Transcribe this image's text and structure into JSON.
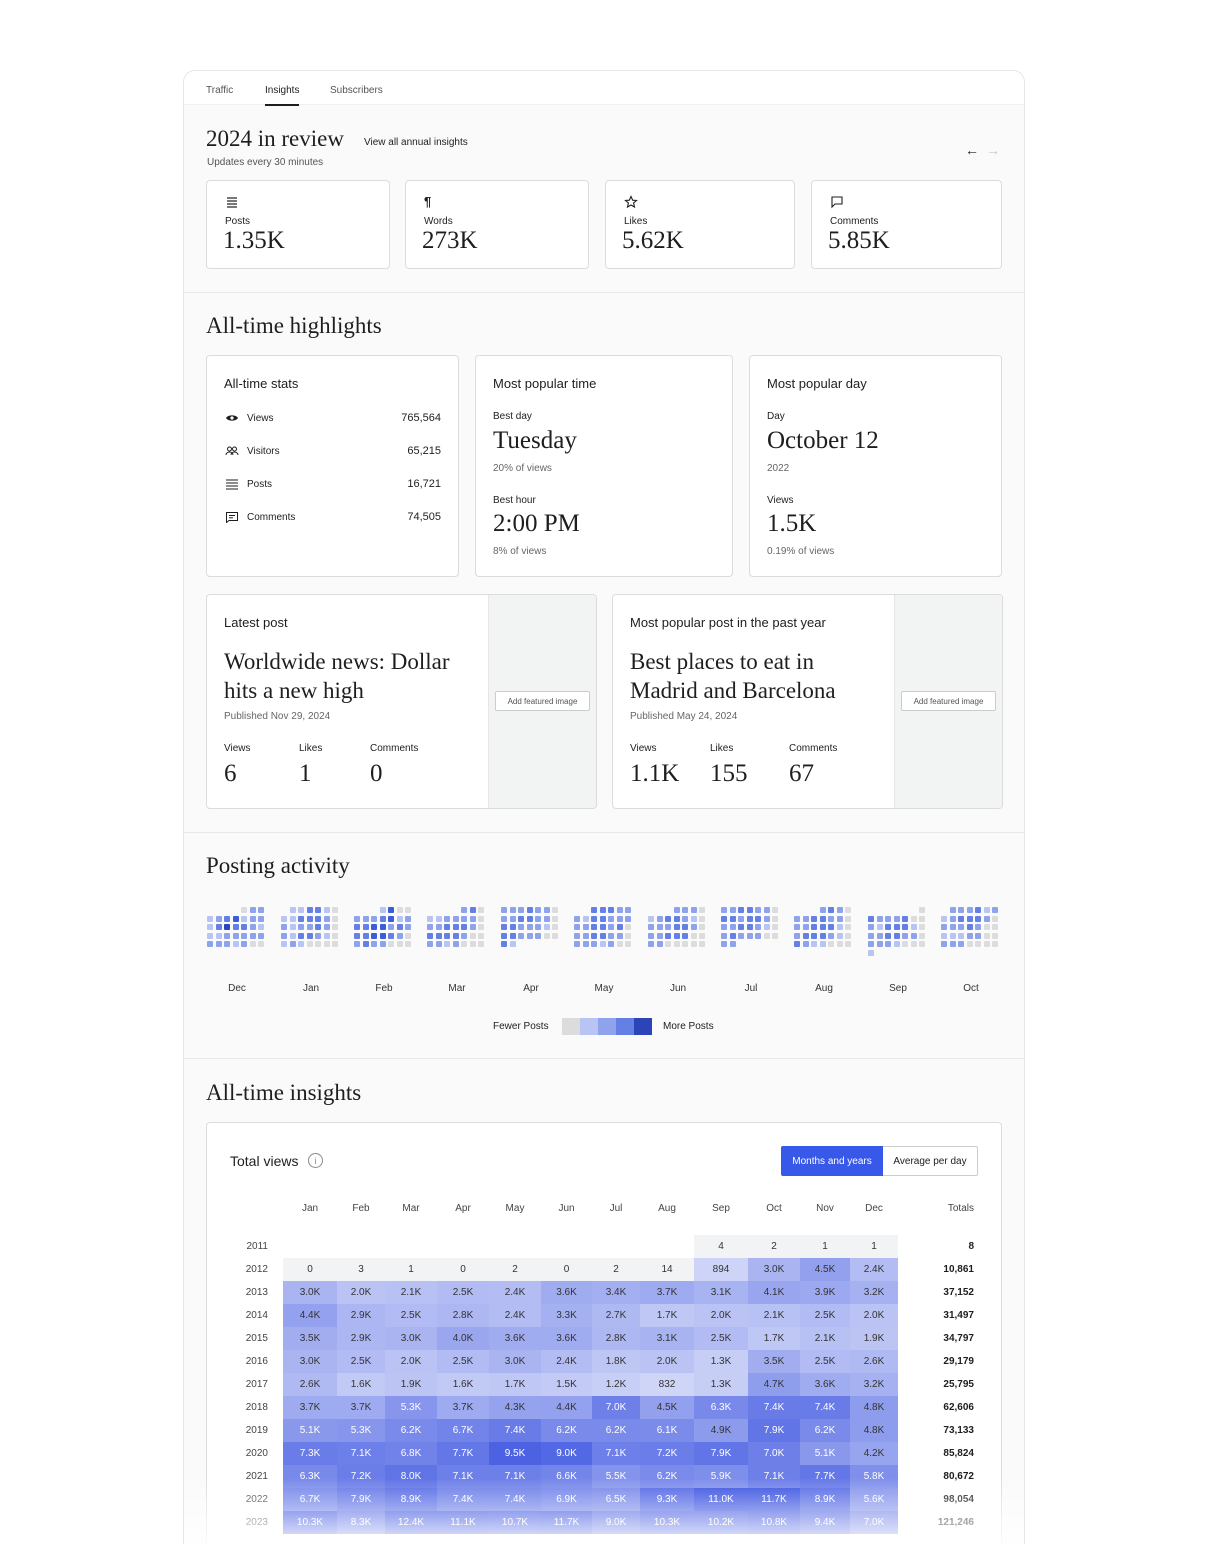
{
  "tabs": [
    "Traffic",
    "Insights",
    "Subscribers"
  ],
  "review": {
    "title": "2024 in review",
    "view_all": "View all annual insights",
    "updates": "Updates every 30 minutes",
    "cards": [
      {
        "icon": "list-icon",
        "label": "Posts",
        "value": "1.35K"
      },
      {
        "icon": "paragraph-icon",
        "label": "Words",
        "value": "273K"
      },
      {
        "icon": "star-icon",
        "label": "Likes",
        "value": "5.62K"
      },
      {
        "icon": "comment-icon",
        "label": "Comments",
        "value": "5.85K"
      }
    ]
  },
  "highlights": {
    "title": "All-time highlights",
    "stats": {
      "title": "All-time stats",
      "rows": [
        {
          "icon": "eye-icon",
          "label": "Views",
          "value": "765,564"
        },
        {
          "icon": "people-icon",
          "label": "Visitors",
          "value": "65,215"
        },
        {
          "icon": "list-icon",
          "label": "Posts",
          "value": "16,721"
        },
        {
          "icon": "comment-icon",
          "label": "Comments",
          "value": "74,505"
        }
      ]
    },
    "popular_time": {
      "title": "Most popular time",
      "best_day_label": "Best day",
      "best_day": "Tuesday",
      "best_day_pct": "20% of views",
      "best_hour_label": "Best hour",
      "best_hour": "2:00 PM",
      "best_hour_pct": "8% of views"
    },
    "popular_day": {
      "title": "Most popular day",
      "day_label": "Day",
      "day": "October 12",
      "year": "2022",
      "views_label": "Views",
      "views": "1.5K",
      "views_pct": "0.19% of views"
    },
    "latest_post": {
      "title": "Latest post",
      "post_title": "Worldwide news: Dollar hits a new high",
      "published": "Published Nov 29, 2024",
      "views_label": "Views",
      "views": "6",
      "likes_label": "Likes",
      "likes": "1",
      "comments_label": "Comments",
      "comments": "0",
      "add_image": "Add featured image"
    },
    "popular_post": {
      "title": "Most popular post in the past year",
      "post_title": "Best places to eat in Madrid and Barcelona",
      "published": "Published May 24, 2024",
      "views_label": "Views",
      "views": "1.1K",
      "likes_label": "Likes",
      "likes": "155",
      "comments_label": "Comments",
      "comments": "67",
      "add_image": "Add featured image"
    }
  },
  "posting_activity": {
    "title": "Posting activity",
    "months": [
      "Dec",
      "Jan",
      "Feb",
      "Mar",
      "Apr",
      "May",
      "Jun",
      "Jul",
      "Aug",
      "Sep",
      "Oct"
    ],
    "legend_fewer": "Fewer Posts",
    "legend_more": "More Posts",
    "colors": [
      "#dcdcdc",
      "#b8c4f3",
      "#8fa2ec",
      "#6580e4",
      "#3d5cd9",
      "#2b45b8"
    ]
  },
  "insights": {
    "title": "All-time insights",
    "card_title": "Total views",
    "toggle_active": "Months and years",
    "toggle_other": "Average per day",
    "month_headers": [
      "Jan",
      "Feb",
      "Mar",
      "Apr",
      "May",
      "Jun",
      "Jul",
      "Aug",
      "Sep",
      "Oct",
      "Nov",
      "Dec"
    ],
    "totals_header": "Totals",
    "rows": [
      {
        "year": "2011",
        "cells": [
          "",
          "",
          "",
          "",
          "",
          "",
          "",
          "",
          "4",
          "2",
          "1",
          "1"
        ],
        "total": "8"
      },
      {
        "year": "2012",
        "cells": [
          "0",
          "3",
          "1",
          "0",
          "2",
          "0",
          "2",
          "14",
          "894",
          "3.0K",
          "4.5K",
          "2.4K"
        ],
        "total": "10,861"
      },
      {
        "year": "2013",
        "cells": [
          "3.0K",
          "2.0K",
          "2.1K",
          "2.5K",
          "2.4K",
          "3.6K",
          "3.4K",
          "3.7K",
          "3.1K",
          "4.1K",
          "3.9K",
          "3.2K"
        ],
        "total": "37,152"
      },
      {
        "year": "2014",
        "cells": [
          "4.4K",
          "2.9K",
          "2.5K",
          "2.8K",
          "2.4K",
          "3.3K",
          "2.7K",
          "1.7K",
          "2.0K",
          "2.1K",
          "2.5K",
          "2.0K"
        ],
        "total": "31,497"
      },
      {
        "year": "2015",
        "cells": [
          "3.5K",
          "2.9K",
          "3.0K",
          "4.0K",
          "3.6K",
          "3.6K",
          "2.8K",
          "3.1K",
          "2.5K",
          "1.7K",
          "2.1K",
          "1.9K"
        ],
        "total": "34,797"
      },
      {
        "year": "2016",
        "cells": [
          "3.0K",
          "2.5K",
          "2.0K",
          "2.5K",
          "3.0K",
          "2.4K",
          "1.8K",
          "2.0K",
          "1.3K",
          "3.5K",
          "2.5K",
          "2.6K"
        ],
        "total": "29,179"
      },
      {
        "year": "2017",
        "cells": [
          "2.6K",
          "1.6K",
          "1.9K",
          "1.6K",
          "1.7K",
          "1.5K",
          "1.2K",
          "832",
          "1.3K",
          "4.7K",
          "3.6K",
          "3.2K"
        ],
        "total": "25,795"
      },
      {
        "year": "2018",
        "cells": [
          "3.7K",
          "3.7K",
          "5.3K",
          "3.7K",
          "4.3K",
          "4.4K",
          "7.0K",
          "4.5K",
          "6.3K",
          "7.4K",
          "7.4K",
          "4.8K"
        ],
        "total": "62,606"
      },
      {
        "year": "2019",
        "cells": [
          "5.1K",
          "5.3K",
          "6.2K",
          "6.7K",
          "7.4K",
          "6.2K",
          "6.2K",
          "6.1K",
          "4.9K",
          "7.9K",
          "6.2K",
          "4.8K"
        ],
        "total": "73,133"
      },
      {
        "year": "2020",
        "cells": [
          "7.3K",
          "7.1K",
          "6.8K",
          "7.7K",
          "9.5K",
          "9.0K",
          "7.1K",
          "7.2K",
          "7.9K",
          "7.0K",
          "5.1K",
          "4.2K"
        ],
        "total": "85,824"
      },
      {
        "year": "2021",
        "cells": [
          "6.3K",
          "7.2K",
          "8.0K",
          "7.1K",
          "7.1K",
          "6.6K",
          "5.5K",
          "6.2K",
          "5.9K",
          "7.1K",
          "7.7K",
          "5.8K"
        ],
        "total": "80,672"
      },
      {
        "year": "2022",
        "cells": [
          "6.7K",
          "7.9K",
          "8.9K",
          "7.4K",
          "7.4K",
          "6.9K",
          "6.5K",
          "9.3K",
          "11.0K",
          "11.7K",
          "8.9K",
          "5.6K"
        ],
        "total": "98,054"
      },
      {
        "year": "2023",
        "cells": [
          "10.3K",
          "8.3K",
          "12.4K",
          "11.1K",
          "10.7K",
          "11.7K",
          "9.0K",
          "10.3K",
          "10.2K",
          "10.8K",
          "9.4K",
          "7.0K"
        ],
        "total": "121,246"
      }
    ]
  }
}
